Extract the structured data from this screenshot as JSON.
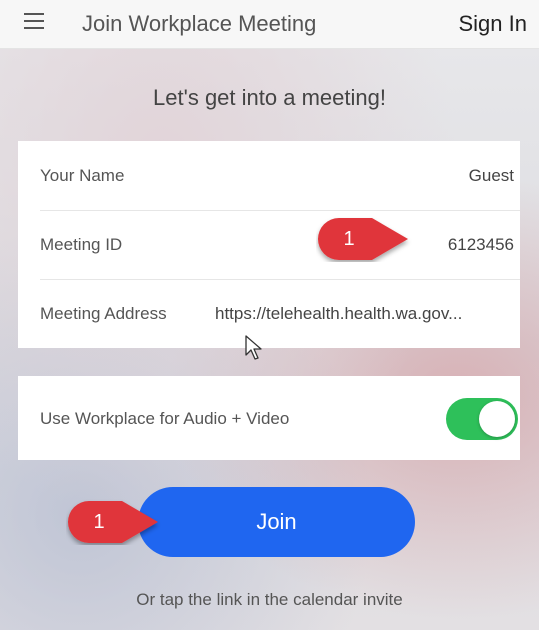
{
  "header": {
    "title": "Join Workplace Meeting",
    "sign_in_label": "Sign In"
  },
  "heading": "Let's get into a meeting!",
  "form": {
    "rows": [
      {
        "label": "Your Name",
        "value": "Guest"
      },
      {
        "label": "Meeting ID",
        "value": "6123456"
      },
      {
        "label": "Meeting Address",
        "value": "https://telehealth.health.wa.gov..."
      }
    ]
  },
  "audio_video": {
    "label": "Use Workplace for Audio + Video",
    "enabled": true
  },
  "join_label": "Join",
  "hint": "Or tap the link in the calendar invite",
  "callouts": [
    {
      "number": "1"
    },
    {
      "number": "1"
    }
  ],
  "colors": {
    "accent": "#1f66f0",
    "toggle_on": "#2ec05a",
    "callout": "#e0343a"
  }
}
